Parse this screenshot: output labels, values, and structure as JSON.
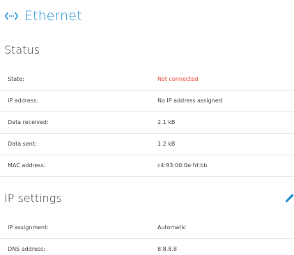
{
  "header": {
    "title": "Ethernet",
    "icon": "ethernet-icon",
    "accent_color": "#1a8fd1"
  },
  "status": {
    "title": "Status",
    "rows": [
      {
        "label": "State:",
        "value": "Not connected",
        "value_color": "#e8463b"
      },
      {
        "label": "IP address:",
        "value": "No IP address assigned"
      },
      {
        "label": "Data received:",
        "value": "2.1 kB"
      },
      {
        "label": "Data sent:",
        "value": "1.2 kB"
      },
      {
        "label": "MAC address:",
        "value": "c4:93:00:0e:fd:bb"
      }
    ]
  },
  "ip_settings": {
    "title": "IP settings",
    "edit_icon": "pencil-icon",
    "rows": [
      {
        "label": "IP assignment:",
        "value": "Automatic"
      },
      {
        "label": "DNS address:",
        "value": "8.8.8.8"
      }
    ]
  }
}
